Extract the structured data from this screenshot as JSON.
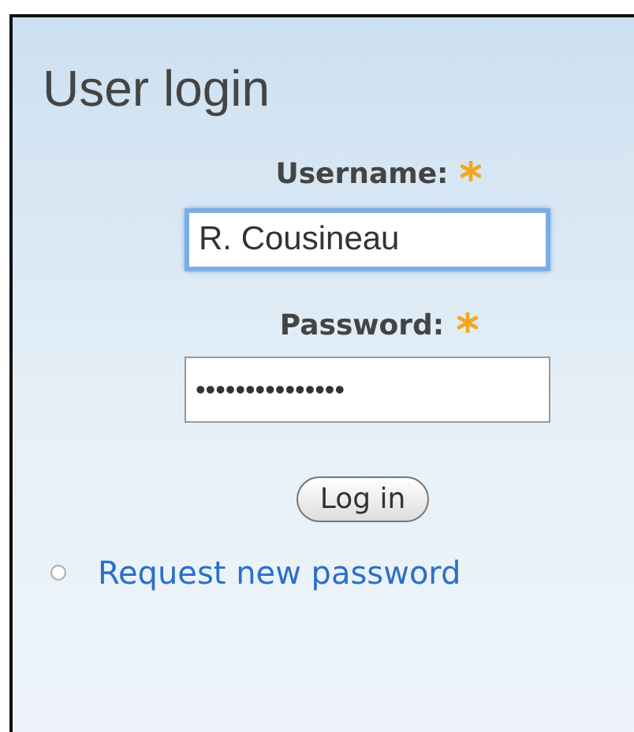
{
  "block": {
    "title": "User login"
  },
  "fields": [
    {
      "label": "Username:",
      "required": true,
      "value": "R. Cousineau",
      "focused": true
    },
    {
      "label": "Password:",
      "required": true,
      "value": "•••••••••••••••",
      "focused": false
    }
  ],
  "button": "Log in",
  "links": [
    "Request new password"
  ]
}
